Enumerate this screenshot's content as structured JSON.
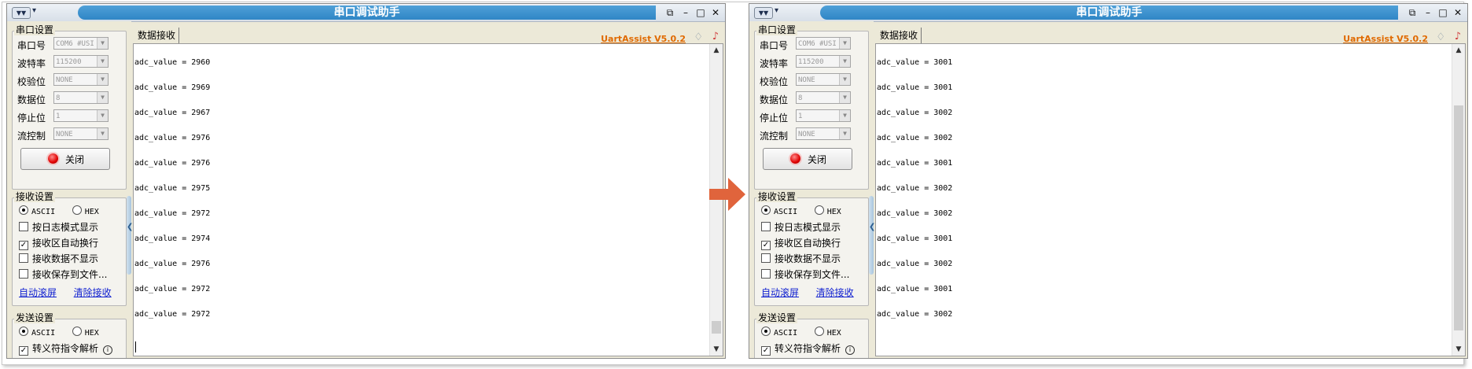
{
  "windows": [
    {
      "title": "串口调试助手",
      "port_settings": {
        "title": "串口设置",
        "rows": [
          {
            "label": "串口号",
            "value": "COM6 #USI"
          },
          {
            "label": "波特率",
            "value": "115200"
          },
          {
            "label": "校验位",
            "value": "NONE"
          },
          {
            "label": "数据位",
            "value": "8"
          },
          {
            "label": "停止位",
            "value": "1"
          },
          {
            "label": "流控制",
            "value": "NONE"
          }
        ],
        "close_button": "关闭"
      },
      "recv_settings": {
        "title": "接收设置",
        "ascii": "ASCII",
        "hex": "HEX",
        "options": [
          {
            "label": "按日志模式显示",
            "checked": false
          },
          {
            "label": "接收区自动换行",
            "checked": true
          },
          {
            "label": "接收数据不显示",
            "checked": false
          },
          {
            "label": "接收保存到文件...",
            "checked": false
          }
        ],
        "links": [
          "自动滚屏",
          "清除接收"
        ]
      },
      "send_settings": {
        "title": "发送设置",
        "ascii": "ASCII",
        "hex": "HEX",
        "escape_option": "转义符指令解析"
      },
      "tab_label": "数据接收",
      "version": "UartAssist V5.0.2",
      "lines": [
        "adc_value = 2960",
        "adc_value = 2969",
        "adc_value = 2967",
        "adc_value = 2976",
        "adc_value = 2976",
        "adc_value = 2975",
        "adc_value = 2972",
        "adc_value = 2974",
        "adc_value = 2976",
        "adc_value = 2972",
        "adc_value = 2972"
      ],
      "scroll_position": "bottom"
    },
    {
      "title": "串口调试助手",
      "port_settings": {
        "title": "串口设置",
        "rows": [
          {
            "label": "串口号",
            "value": "COM6 #USI"
          },
          {
            "label": "波特率",
            "value": "115200"
          },
          {
            "label": "校验位",
            "value": "NONE"
          },
          {
            "label": "数据位",
            "value": "8"
          },
          {
            "label": "停止位",
            "value": "1"
          },
          {
            "label": "流控制",
            "value": "NONE"
          }
        ],
        "close_button": "关闭"
      },
      "recv_settings": {
        "title": "接收设置",
        "ascii": "ASCII",
        "hex": "HEX",
        "options": [
          {
            "label": "按日志模式显示",
            "checked": false
          },
          {
            "label": "接收区自动换行",
            "checked": true
          },
          {
            "label": "接收数据不显示",
            "checked": false
          },
          {
            "label": "接收保存到文件...",
            "checked": false
          }
        ],
        "links": [
          "自动滚屏",
          "清除接收"
        ]
      },
      "send_settings": {
        "title": "发送设置",
        "ascii": "ASCII",
        "hex": "HEX",
        "escape_option": "转义符指令解析"
      },
      "tab_label": "数据接收",
      "version": "UartAssist V5.0.2",
      "lines": [
        "adc_value = 3001",
        "adc_value = 3001",
        "adc_value = 3002",
        "adc_value = 3002",
        "adc_value = 3001",
        "adc_value = 3002",
        "adc_value = 3002",
        "adc_value = 3001",
        "adc_value = 3002",
        "adc_value = 3001",
        "adc_value = 3002"
      ],
      "scroll_position": "middle"
    }
  ],
  "arrow_color": "#e0643c"
}
